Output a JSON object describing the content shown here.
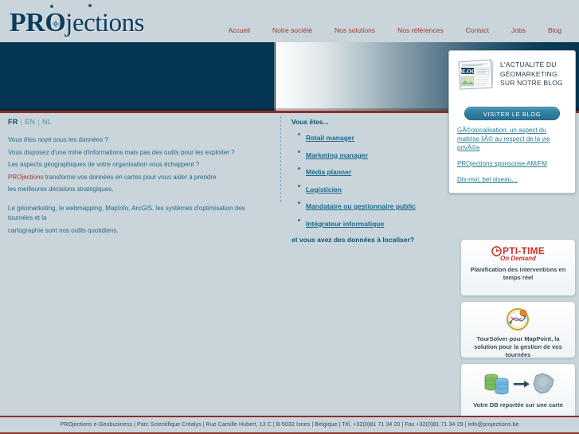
{
  "site": {
    "logo_pro": "PRO",
    "logo_jections": "jections"
  },
  "nav": {
    "items": [
      {
        "label": "Accueil"
      },
      {
        "label": "Notre société"
      },
      {
        "label": "Nos solutions"
      },
      {
        "label": "Nos références"
      },
      {
        "label": "Contact"
      },
      {
        "label": "Jobs"
      },
      {
        "label": "Blog"
      }
    ]
  },
  "blog_promo": {
    "icon": "newspaper-icon",
    "icon_label": "BLOG",
    "headline": "L'ACTUALITÉ DU GÉOMARKETING SUR NOTRE BLOG",
    "button_label": "VISITER LE BLOG",
    "posts": [
      {
        "title": "GÃ©olocalisation: un aspect du maitrise liÃ© au respect de la vie privÃ©e"
      },
      {
        "title": "PROjections sponsorise AM/FM"
      },
      {
        "title": "Dis-moi, bel oiseau…"
      }
    ]
  },
  "language": {
    "current": "FR",
    "separator": "|",
    "options": [
      {
        "code": "FR",
        "active": true
      },
      {
        "code": "EN",
        "active": false
      },
      {
        "code": "NL",
        "active": false
      }
    ]
  },
  "intro": {
    "line1": "Vous êtes noyé sous les données ?",
    "line2": "Vous disposez d'une mine d'informations mais pas des outils pour les exploiter ?",
    "line3": "Les aspects géographiques de votre organisation vous échappent ?",
    "line4_brand": "PROjections",
    "line4_rest": " transforme vos données en cartes pour vous aider à prendre",
    "line5": "les meilleures décisions stratégiques.",
    "line6": "Le géomarketing, le webmapping, MapInfo, ArcGIS, les systèmes d'optimisation des tournées et la",
    "line7": "cartographie sont nos outils quotidiens."
  },
  "profiles": {
    "heading": "Vous êtes...",
    "items": [
      {
        "label": "Retail manager"
      },
      {
        "label": "Marketing manager"
      },
      {
        "label": "Média planner"
      },
      {
        "label": "Logisticien"
      },
      {
        "label": "Mandataire ou gestionnaire public"
      },
      {
        "label": "Intégrateur informatique"
      }
    ],
    "closing": "et vous avez des données à localiser?"
  },
  "promos": [
    {
      "id": "optitime",
      "logo_main": "PTI-TIME",
      "logo_sub": "On Demand",
      "icon": "clock-icon",
      "caption": "Planification des interventions en temps réel",
      "accent": "#c8342b"
    },
    {
      "id": "toursolver",
      "icon": "compass-route-icon",
      "caption": "TourSolver pour MapPoint, la solution pour la gestion de vos tournées",
      "accent": "#c9a227"
    },
    {
      "id": "db-map",
      "icon": "database-to-map-icon",
      "caption": "Votre DB reportée sur une carte",
      "accent": "#4a9a3f"
    }
  ],
  "footer": {
    "text": "PROjections e-Geobusiness | Parc Scientifique Créalys | Rue Camille Hubert, 13 C | B-5032 Isnes | Belgique | Tél. +32(0)81 71 34 20 | Fax +32(0)81 71 34 29 | info@projections.be"
  },
  "colors": {
    "navy": "#043551",
    "red_rule": "#8e2f25",
    "nav_link": "#a03b33",
    "teal": "#2a7d96",
    "page_bg": "#c9d4db"
  }
}
